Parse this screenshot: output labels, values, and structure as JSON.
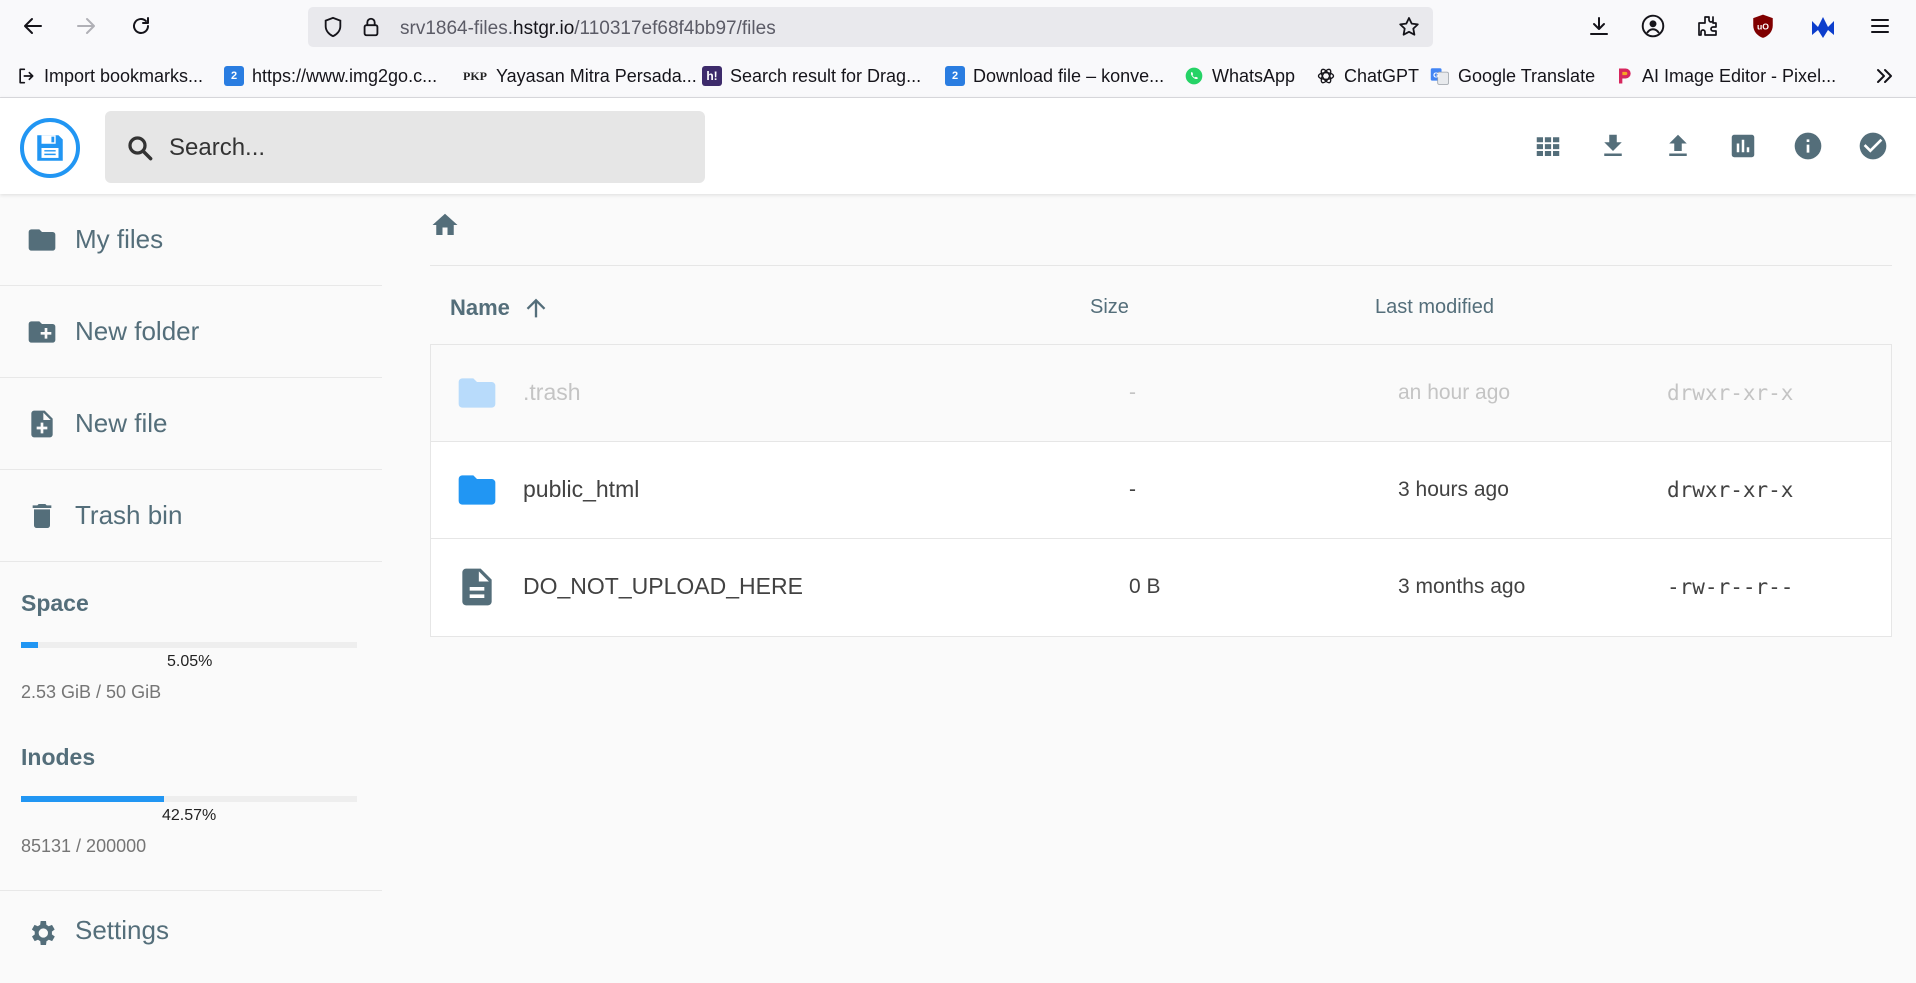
{
  "browser": {
    "url_prefix": "srv1864-files.",
    "url_host": "hstgr.io",
    "url_path": "/110317ef68f4bb97/files",
    "bookmarks": [
      {
        "label": "Import bookmarks...",
        "icon": "import-icon"
      },
      {
        "label": "https://www.img2go.c...",
        "icon": "img2go-icon"
      },
      {
        "label": "Yayasan Mitra Persada...",
        "icon": "pkp-icon"
      },
      {
        "label": "Search result for Drag...",
        "icon": "h-icon"
      },
      {
        "label": "Download file – konve...",
        "icon": "img2go-icon"
      },
      {
        "label": "WhatsApp",
        "icon": "whatsapp-icon"
      },
      {
        "label": "ChatGPT",
        "icon": "chatgpt-icon"
      },
      {
        "label": "Google Translate",
        "icon": "translate-icon"
      },
      {
        "label": "AI Image Editor - Pixel...",
        "icon": "pixelcut-icon"
      }
    ],
    "pkp_glyph": "PKP",
    "h_glyph": "h!",
    "img_glyph": "2",
    "ublock_glyph": "uO",
    "accent": "#0060df"
  },
  "app": {
    "search_placeholder": "Search...",
    "accent": "#2196f3",
    "header_actions": [
      "grid-view-icon",
      "download-icon",
      "upload-icon",
      "chart-icon",
      "info-icon",
      "check-icon"
    ]
  },
  "sidebar": {
    "items": [
      {
        "label": "My files",
        "icon": "folder-icon"
      },
      {
        "label": "New folder",
        "icon": "create-folder-icon"
      },
      {
        "label": "New file",
        "icon": "note-add-icon"
      },
      {
        "label": "Trash bin",
        "icon": "trash-icon"
      }
    ],
    "space": {
      "title": "Space",
      "percent_label": "5.05%",
      "fraction": 0.0505,
      "usage": "2.53 GiB / 50 GiB"
    },
    "inodes": {
      "title": "Inodes",
      "percent_label": "42.57%",
      "fraction": 0.4257,
      "usage": "85131 / 200000"
    },
    "settings_label": "Settings"
  },
  "listing": {
    "columns": {
      "name": "Name",
      "size": "Size",
      "modified": "Last modified"
    },
    "sort": "name-ascending",
    "files": [
      {
        "name": ".trash",
        "size": "-",
        "modified": "an hour ago",
        "perms": "drwxr-xr-x",
        "type": "folder",
        "hidden": true
      },
      {
        "name": "public_html",
        "size": "-",
        "modified": "3 hours ago",
        "perms": "drwxr-xr-x",
        "type": "folder",
        "hidden": false
      },
      {
        "name": "DO_NOT_UPLOAD_HERE",
        "size": "0 B",
        "modified": "3 months ago",
        "perms": "-rw-r--r--",
        "type": "file",
        "hidden": false
      }
    ]
  }
}
